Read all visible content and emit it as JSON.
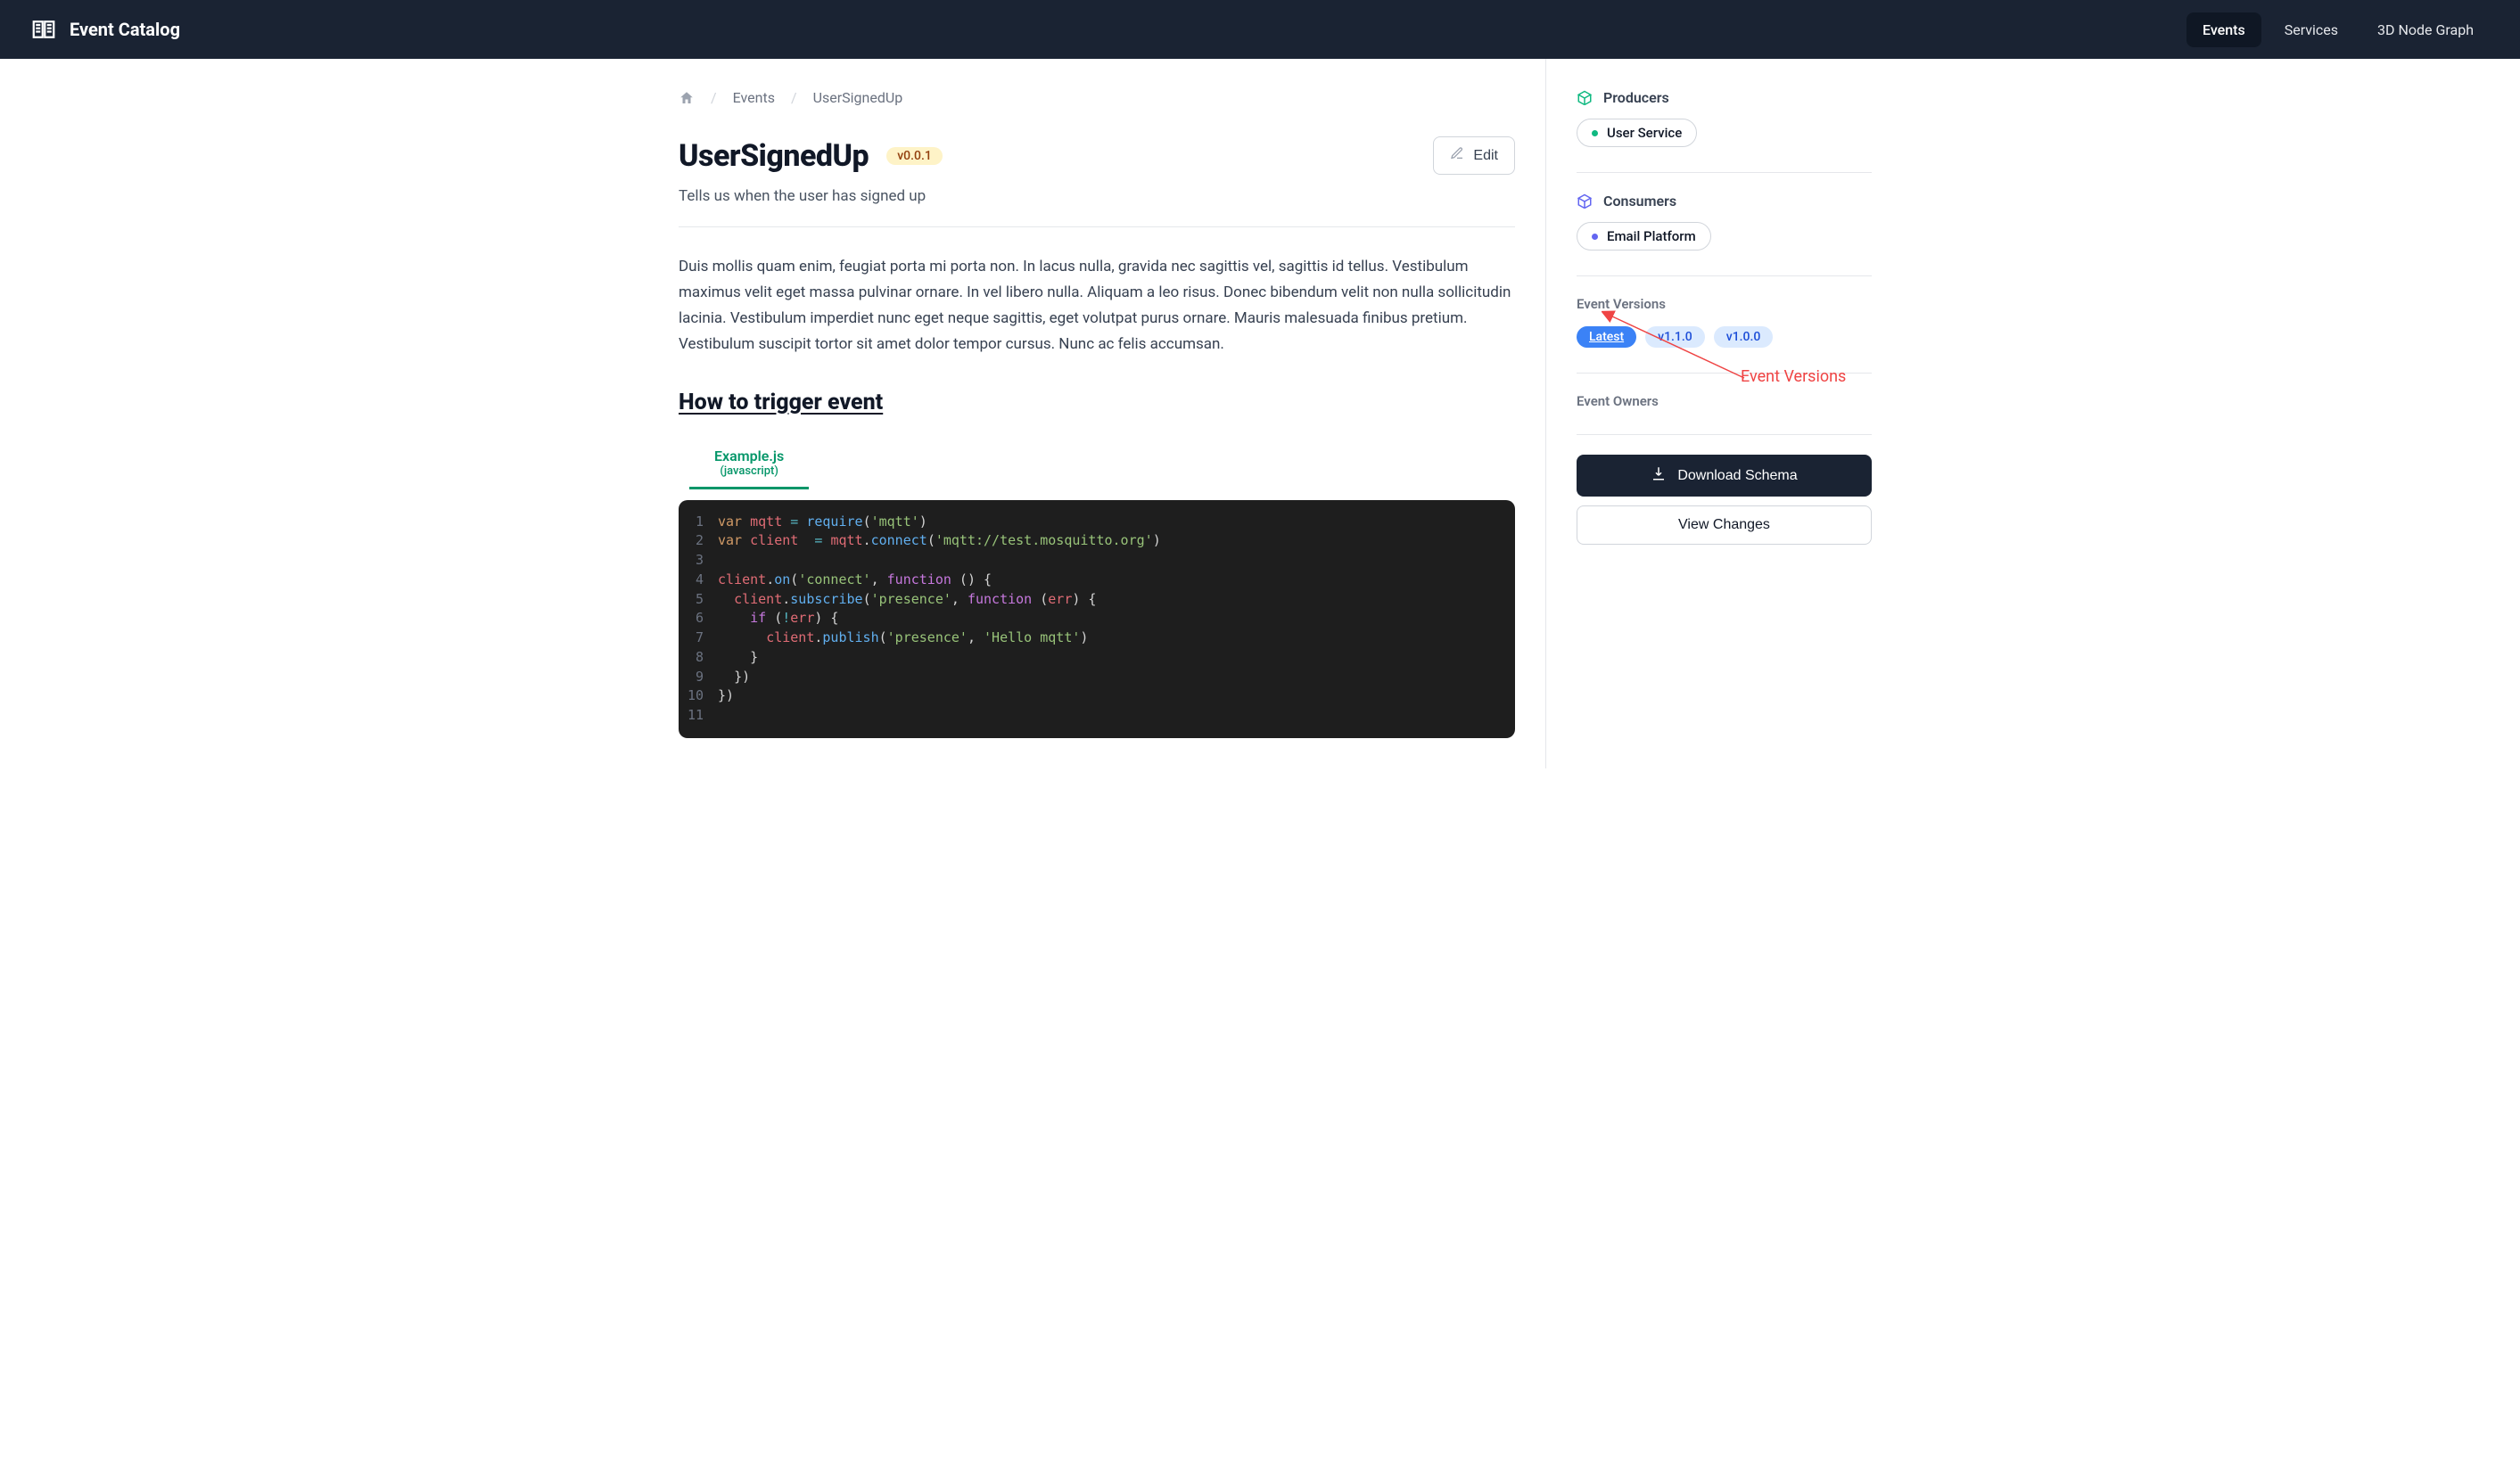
{
  "header": {
    "brand_title": "Event Catalog",
    "nav": [
      {
        "label": "Events",
        "active": true
      },
      {
        "label": "Services",
        "active": false
      },
      {
        "label": "3D Node Graph",
        "active": false
      }
    ]
  },
  "breadcrumb": {
    "items": [
      "Events",
      "UserSignedUp"
    ]
  },
  "page": {
    "title": "UserSignedUp",
    "version_badge": "v0.0.1",
    "edit_label": "Edit",
    "subtitle": "Tells us when the user has signed up",
    "body": "Duis mollis quam enim, feugiat porta mi porta non. In lacus nulla, gravida nec sagittis vel, sagittis id tellus. Vestibulum maximus velit eget massa pulvinar ornare. In vel libero nulla. Aliquam a leo risus. Donec bibendum velit non nulla sollicitudin lacinia. Vestibulum imperdiet nunc eget neque sagittis, eget volutpat purus ornare. Mauris malesuada finibus pretium. Vestibulum suscipit tortor sit amet dolor tempor cursus. Nunc ac felis accumsan.",
    "section_heading": "How to trigger event",
    "code_tab": {
      "name": "Example.js",
      "sub": "(javascript)"
    },
    "code_lines": [
      "var mqtt = require('mqtt')",
      "var client  = mqtt.connect('mqtt://test.mosquitto.org')",
      "",
      "client.on('connect', function () {",
      "  client.subscribe('presence', function (err) {",
      "    if (!err) {",
      "      client.publish('presence', 'Hello mqtt')",
      "    }",
      "  })",
      "})",
      ""
    ]
  },
  "sidebar": {
    "producers_label": "Producers",
    "producers": [
      {
        "name": "User Service"
      }
    ],
    "consumers_label": "Consumers",
    "consumers": [
      {
        "name": "Email Platform"
      }
    ],
    "versions_label": "Event Versions",
    "versions": [
      {
        "label": "Latest",
        "active": true
      },
      {
        "label": "v1.1.0",
        "active": false
      },
      {
        "label": "v1.0.0",
        "active": false
      }
    ],
    "owners_label": "Event Owners",
    "download_label": "Download Schema",
    "view_changes_label": "View Changes",
    "annotation_label": "Event Versions"
  }
}
